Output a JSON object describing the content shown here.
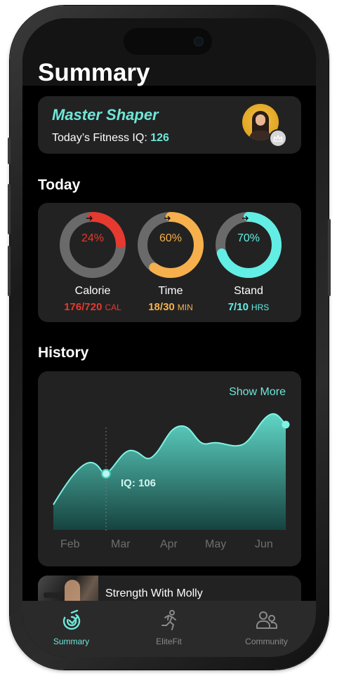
{
  "header": {
    "title": "Summary"
  },
  "profile": {
    "name": "Master Shaper",
    "iq_label": "Today’s Fitness IQ:",
    "iq_value": "126"
  },
  "today": {
    "title": "Today",
    "rings": [
      {
        "label": "Calorie",
        "percent_text": "24%",
        "percent": 0.24,
        "value": "176/720",
        "unit": "CAL",
        "color": "#e6392f"
      },
      {
        "label": "Time",
        "percent_text": "60%",
        "percent": 0.6,
        "value": "18/30",
        "unit": "MIN",
        "color": "#f6b04c"
      },
      {
        "label": "Stand",
        "percent_text": "70%",
        "percent": 0.7,
        "value": "7/10",
        "unit": "HRS",
        "color": "#62eee4"
      }
    ]
  },
  "history": {
    "title": "History",
    "show_more": "Show More",
    "tooltip": "IQ: 106",
    "months": [
      "Feb",
      "Mar",
      "Apr",
      "May",
      "Jun"
    ]
  },
  "workout": {
    "title": "Strength With Molly"
  },
  "tabs": [
    {
      "label": "Summary",
      "icon": "summary-icon",
      "active": true
    },
    {
      "label": "EliteFit",
      "icon": "running-icon",
      "active": false
    },
    {
      "label": "Community",
      "icon": "community-icon",
      "active": false
    }
  ],
  "colors": {
    "accent": "#6ee7d9",
    "card": "#222222",
    "background": "#000000",
    "tab_inactive": "#8a8a8a"
  }
}
